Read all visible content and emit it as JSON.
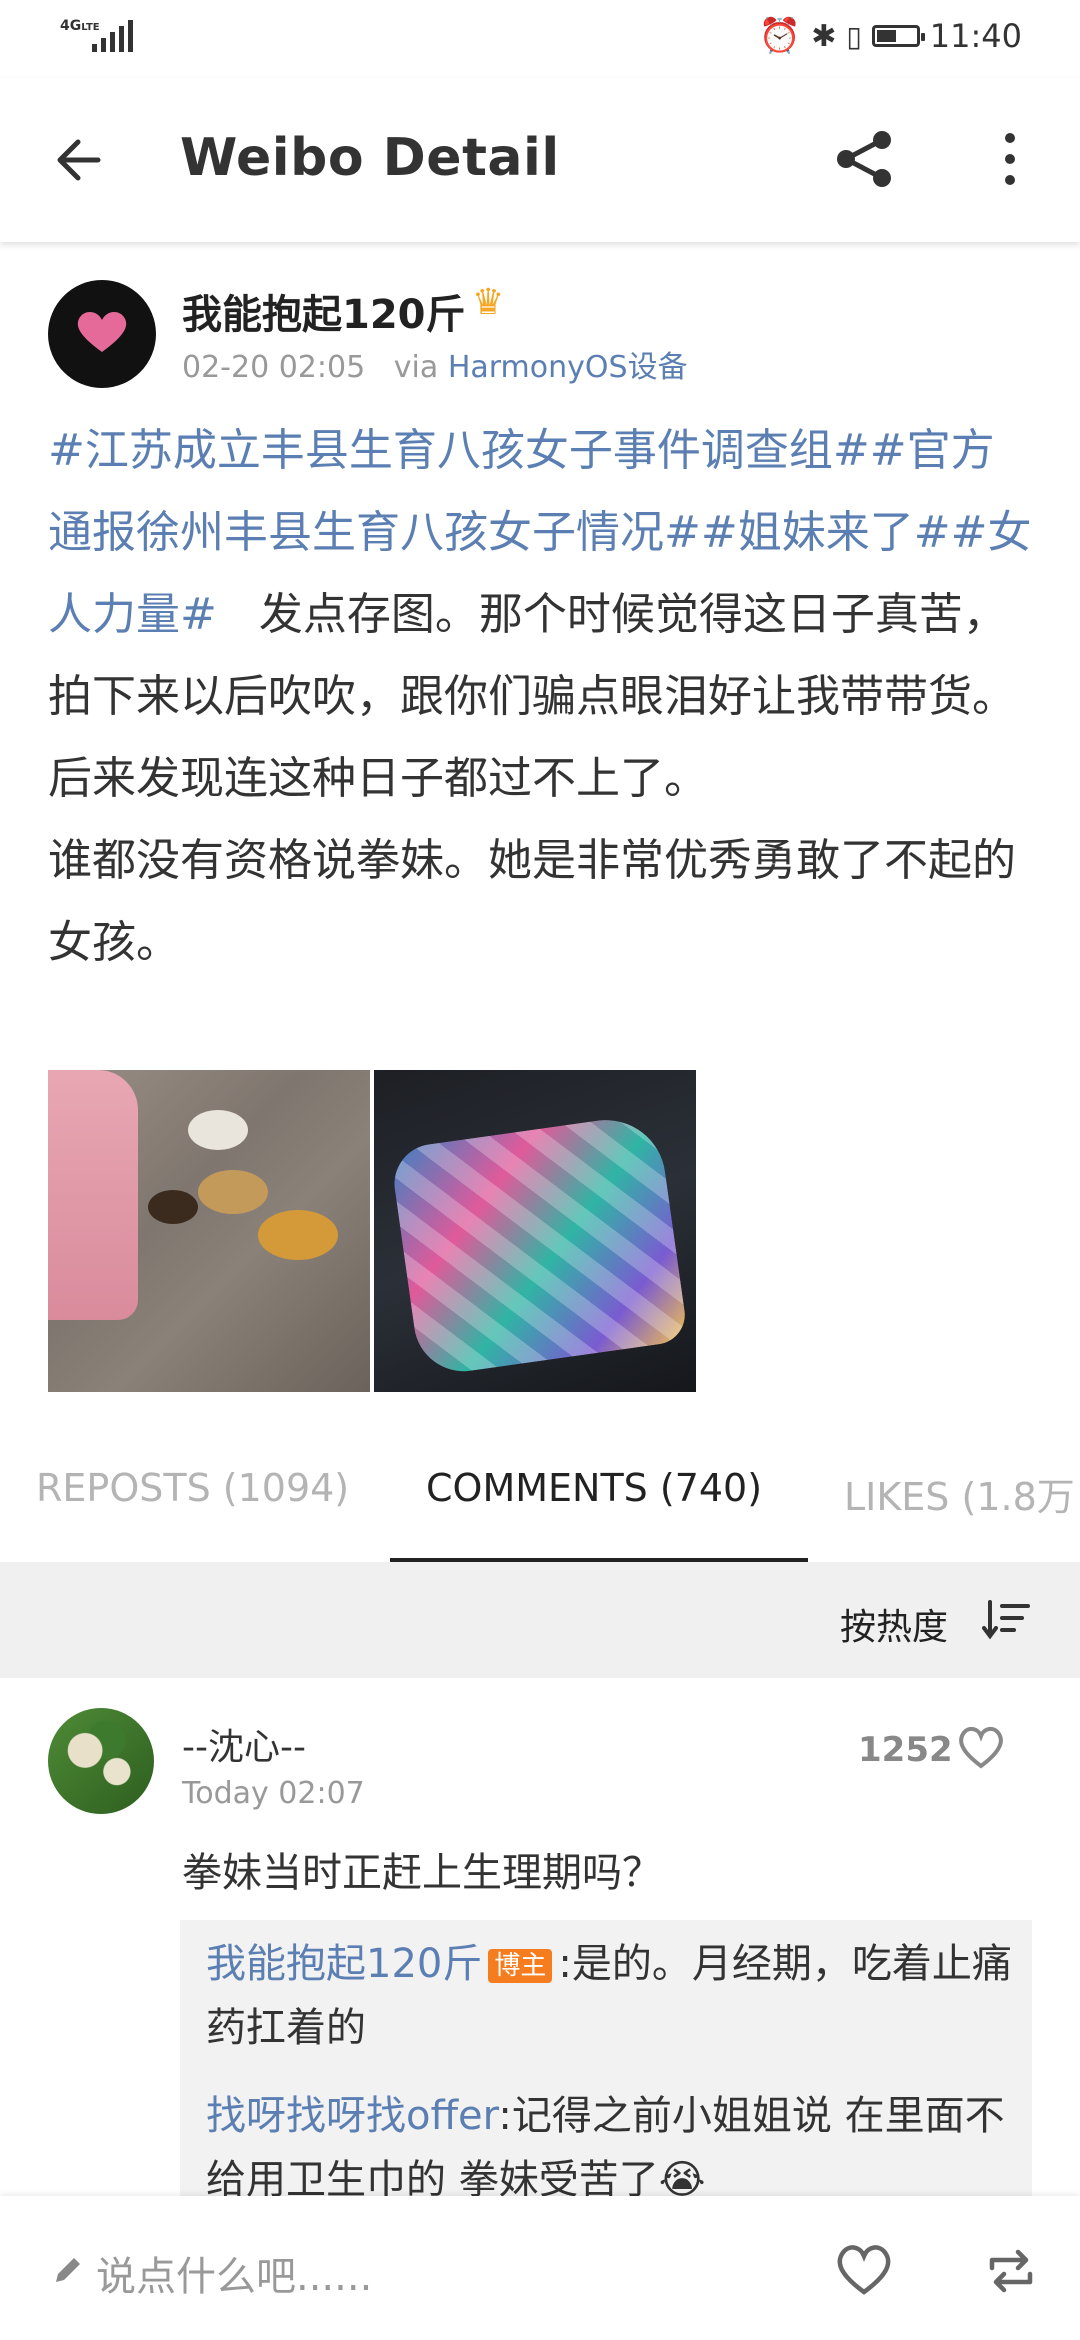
{
  "status_bar": {
    "network": "4G",
    "network_sub": "LTE",
    "time": "11:40",
    "battery_level": 0.5
  },
  "app_bar": {
    "title": "Weibo Detail"
  },
  "post": {
    "author": "我能抱起120斤",
    "timestamp": "02-20 02:05",
    "via_prefix": "via",
    "via_source": "HarmonyOS设备",
    "hashtags": [
      "#江苏成立丰县生育八孩女子事件调查组#",
      "#官方通报徐州丰县生育八孩女子情况#",
      "#姐妹来了#",
      "#女人力量#"
    ],
    "body": "发点存图。那个时候觉得这日子真苦，拍下来以后吹吹，跟你们骗点眼泪好让我带带货。后来发现连这种日子都过不上了。",
    "body2": "谁都没有资格说拳妹。她是非常优秀勇敢了不起的女孩。"
  },
  "tabs": [
    {
      "label": "REPOSTS (1094)"
    },
    {
      "label": "COMMENTS (740)"
    },
    {
      "label": "LIKES (1.8万"
    }
  ],
  "sort": {
    "label": "按热度"
  },
  "comment": {
    "user": "--沈心--",
    "time": "Today 02:07",
    "likes": "1252",
    "text": "拳妹当时正赶上生理期吗？",
    "replies": [
      {
        "user": "我能抱起120斤",
        "badge": "博主",
        "text": ":是的。月经期，吃着止痛药扛着的"
      },
      {
        "user": "找呀找呀找offer",
        "text": ":记得之前小姐姐说 在里面不给用卫生巾的 拳妹受苦了😭"
      }
    ]
  },
  "bottom_bar": {
    "placeholder": "说点什么吧......"
  },
  "icons": {
    "back": "arrow-left-icon",
    "share": "share-icon",
    "more": "more-vertical-icon",
    "sort": "sort-icon",
    "like": "heart-icon",
    "repost": "repost-icon",
    "edit": "pencil-icon",
    "crown": "crown-icon",
    "alarm": "alarm-icon",
    "bluetooth": "bluetooth-icon",
    "vibrate": "vibrate-icon"
  },
  "colors": {
    "link": "#5b7fb2",
    "badge": "#f57c1f",
    "sort_bg": "#f0f0f0"
  }
}
